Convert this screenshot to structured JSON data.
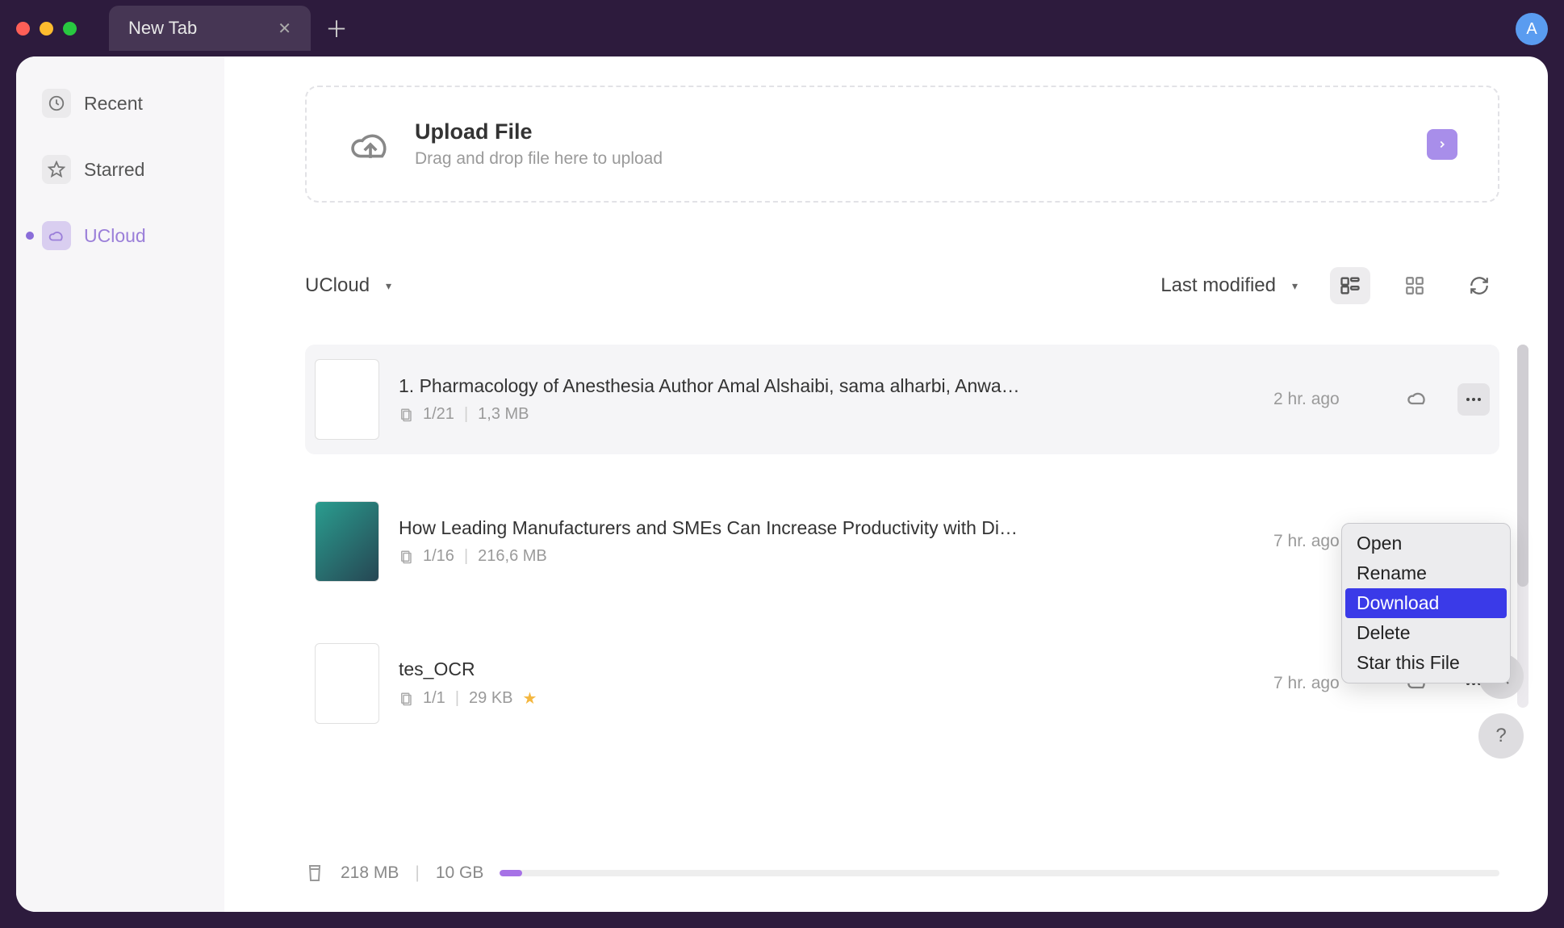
{
  "titlebar": {
    "tab_label": "New Tab",
    "avatar_initial": "A"
  },
  "sidebar": {
    "items": [
      {
        "label": "Recent",
        "icon": "clock"
      },
      {
        "label": "Starred",
        "icon": "star"
      },
      {
        "label": "UCloud",
        "icon": "cloud",
        "active": true
      }
    ]
  },
  "upload": {
    "title": "Upload File",
    "subtitle": "Drag and drop file here to upload"
  },
  "toolbar": {
    "folder_dropdown": "UCloud",
    "sort_dropdown": "Last modified"
  },
  "files": [
    {
      "name": "1. Pharmacology of Anesthesia Author Amal Alshaibi, sama alharbi, Anwa…",
      "pages": "1/21",
      "size": "1,3 MB",
      "time": "2 hr. ago",
      "starred": false
    },
    {
      "name": "How Leading Manufacturers and SMEs Can Increase Productivity with Di…",
      "pages": "1/16",
      "size": "216,6 MB",
      "time": "7 hr. ago",
      "starred": false
    },
    {
      "name": "tes_OCR",
      "pages": "1/1",
      "size": "29 KB",
      "time": "7 hr. ago",
      "starred": true
    }
  ],
  "storage": {
    "used": "218 MB",
    "total": "10 GB"
  },
  "context_menu": {
    "items": [
      "Open",
      "Rename",
      "Download",
      "Delete",
      "Star this File"
    ],
    "highlighted_index": 2
  }
}
